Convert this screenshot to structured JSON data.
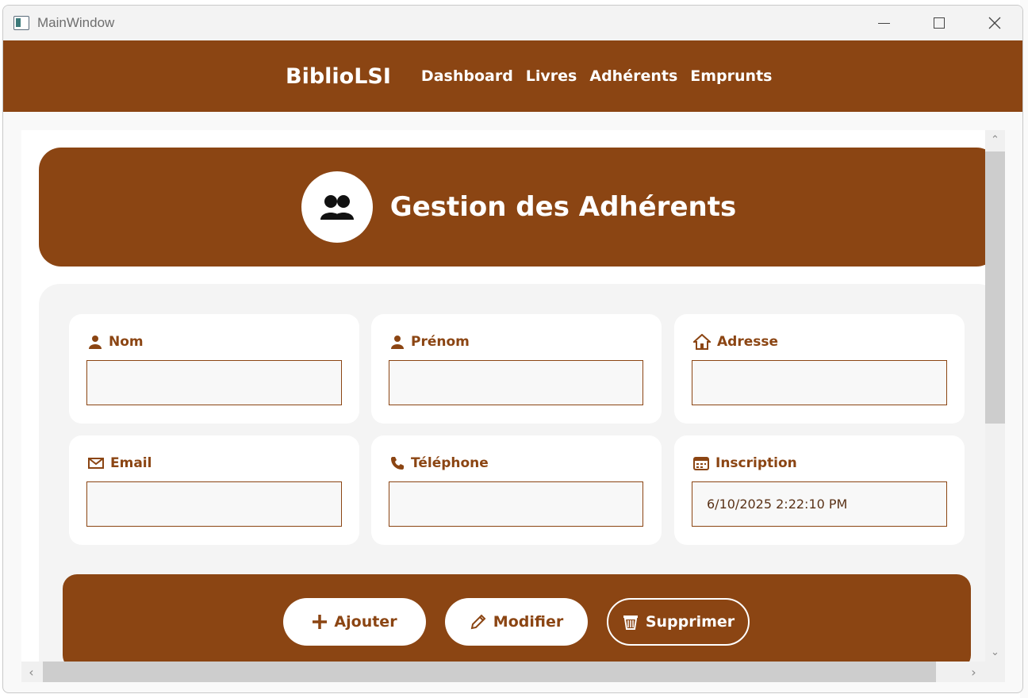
{
  "window": {
    "title": "MainWindow"
  },
  "navbar": {
    "brand": "BiblioLSI",
    "links": [
      "Dashboard",
      "Livres",
      "Adhérents",
      "Emprunts"
    ]
  },
  "header": {
    "title": "Gestion des Adhérents",
    "icon": "users-icon"
  },
  "form": {
    "nom": {
      "label": "Nom",
      "value": "",
      "icon": "person-icon"
    },
    "prenom": {
      "label": "Prénom",
      "value": "",
      "icon": "person-icon"
    },
    "adresse": {
      "label": "Adresse",
      "value": "",
      "icon": "house-icon"
    },
    "email": {
      "label": "Email",
      "value": "",
      "icon": "email-icon"
    },
    "telephone": {
      "label": "Téléphone",
      "value": "",
      "icon": "phone-icon"
    },
    "inscription": {
      "label": "Inscription",
      "value": "6/10/2025 2:22:10 PM",
      "icon": "calendar-icon"
    }
  },
  "actions": {
    "add_label": "Ajouter",
    "edit_label": "Modifier",
    "delete_label": "Supprimer"
  },
  "colors": {
    "accent": "#8B4513",
    "panel": "#F4F4F4",
    "card": "#FFFFFF"
  }
}
